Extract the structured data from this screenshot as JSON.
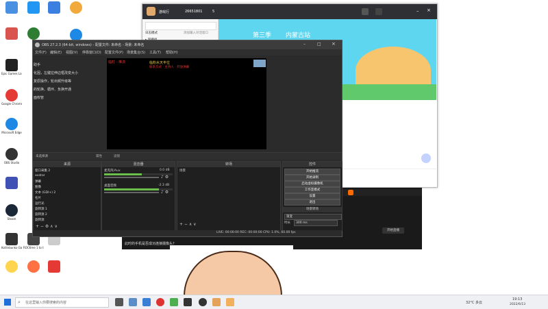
{
  "desktop": {
    "icons": [
      {
        "label": "",
        "color": "#4a90e2"
      },
      {
        "label": "",
        "color": "#2196f3"
      },
      {
        "label": "",
        "color": "#3b7fe0"
      },
      {
        "label": "",
        "color": "#f2a93b"
      },
      {
        "label": "",
        "color": "#d9534f"
      },
      {
        "label": "",
        "color": "#2e7d32"
      },
      {
        "label": "",
        "color": "#1e88e5"
      },
      {
        "label": "Epic Games Launcher",
        "color": "#222222"
      },
      {
        "label": "Google Chrome",
        "color": "#e53935"
      },
      {
        "label": "Microsoft Edge",
        "color": "#1e88e5"
      },
      {
        "label": "OBS Studio",
        "color": "#333333"
      },
      {
        "label": "",
        "color": "#3f51b5"
      },
      {
        "label": "Steam",
        "color": "#1b2838"
      },
      {
        "label": "Kotlinbunko Gamer L...",
        "color": "#333333"
      },
      {
        "label": "ROCKme 1 to the...",
        "color": "#444444"
      },
      {
        "label": "",
        "color": "#cccccc"
      },
      {
        "label": "",
        "color": "#ffd54f"
      },
      {
        "label": "",
        "color": "#ff7043"
      },
      {
        "label": "",
        "color": "#e53935"
      }
    ],
    "cutoff_text": [
      "助手",
      "化因，左键拉伸边框改变大小",
      "",
      "复原操作，轮出频升级等",
      "",
      "的轮换、循环、负换开通",
      "面权管"
    ]
  },
  "obs": {
    "title": "OBS 27.2.3 (64-bit, windows) - 配置文件: 未命名 - 场景: 未命名",
    "menu": [
      "文件(F)",
      "编辑(E)",
      "视图(V)",
      "停靠窗口(D)",
      "配置文件(P)",
      "场景集合(S)",
      "工具(T)",
      "帮助(H)"
    ],
    "preview_text_red": "临时 - 推流",
    "preview_text_title": "临粉水天丰位",
    "preview_text_sub": "联系方式 · 主持人 · 开放弹幕",
    "no_source": "未选择源",
    "properties_label": "属性",
    "filters_label": "滤镜",
    "sources_header": "来源",
    "mixer_header": "混音器",
    "scenes_header": "转场",
    "controls_header": "控件",
    "sources": [
      "窗口采集 2",
      "avatar",
      "弹幕",
      "图像",
      "文本 (GDI+) 2",
      "名片",
      "运行光",
      "旋转源 1",
      "旋转源 2",
      "旋转源"
    ],
    "mixer": [
      {
        "name": "麦克风/Aux",
        "level": "0.0 dB",
        "fill": 0.55
      },
      {
        "name": "桌面音频",
        "level": "-2.3 dB",
        "fill": 0.8
      }
    ],
    "scenes_label": "场景",
    "controls": [
      "开始推流",
      "开始录制",
      "启动虚拟摄像机",
      "工作室模式",
      "设置",
      "退出"
    ],
    "transition_header": "场景转场",
    "transition_value": "渐变",
    "duration_label": "时长",
    "duration_value": "300 ms",
    "status": "LIVE: 00:00:00   REC: 00:00:00   CPU: 1.0%, 60.00 fps"
  },
  "chat": {
    "name": "游戏行",
    "id": "26651801",
    "count": "5",
    "filter": "日志模式",
    "search_placeholder": "添加输入对话窗口",
    "group": "▸ 回播组",
    "banner_season": "第三季",
    "banner_location": "内蒙古站"
  },
  "live": {
    "banner": "此时的手机是否成功连接摄像头?",
    "right_button": "开始直播",
    "status_label": "观看",
    "quality": "高清画质"
  },
  "taskbar": {
    "search_placeholder": "在这里输入你要搜索的内容",
    "weather": "32°C 多云",
    "time": "19:13",
    "date": "2022/6/13"
  }
}
